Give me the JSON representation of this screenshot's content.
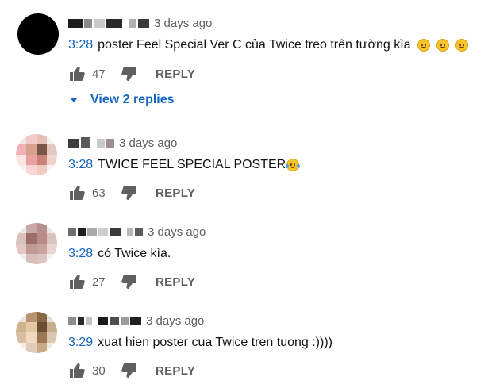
{
  "comments": [
    {
      "timestamp": "3 days ago",
      "video_time": "3:28",
      "text": "poster Feel Special Ver C của Twice treo trên tường kìa",
      "emojis": [
        "smile",
        "smile",
        "smile"
      ],
      "likes": "47",
      "reply_label": "REPLY",
      "view_replies": "View 2 replies"
    },
    {
      "timestamp": "3 days ago",
      "video_time": "3:28",
      "text": "TWICE FEEL SPECIAL POSTER",
      "emojis": [
        "laugh-tears"
      ],
      "likes": "63",
      "reply_label": "REPLY"
    },
    {
      "timestamp": "3 days ago",
      "video_time": "3:28",
      "text": "có Twice kìa.",
      "likes": "27",
      "reply_label": "REPLY"
    },
    {
      "timestamp": "3 days ago",
      "video_time": "3:29",
      "text": "xuat hien poster cua Twice tren tuong :))))",
      "likes": "30",
      "reply_label": "REPLY"
    }
  ],
  "icons": {
    "like": "thumb-up-icon",
    "dislike": "thumb-down-icon",
    "expand": "caret-down-icon"
  },
  "colors": {
    "link": "#1565c0",
    "secondary_text": "#606060"
  }
}
